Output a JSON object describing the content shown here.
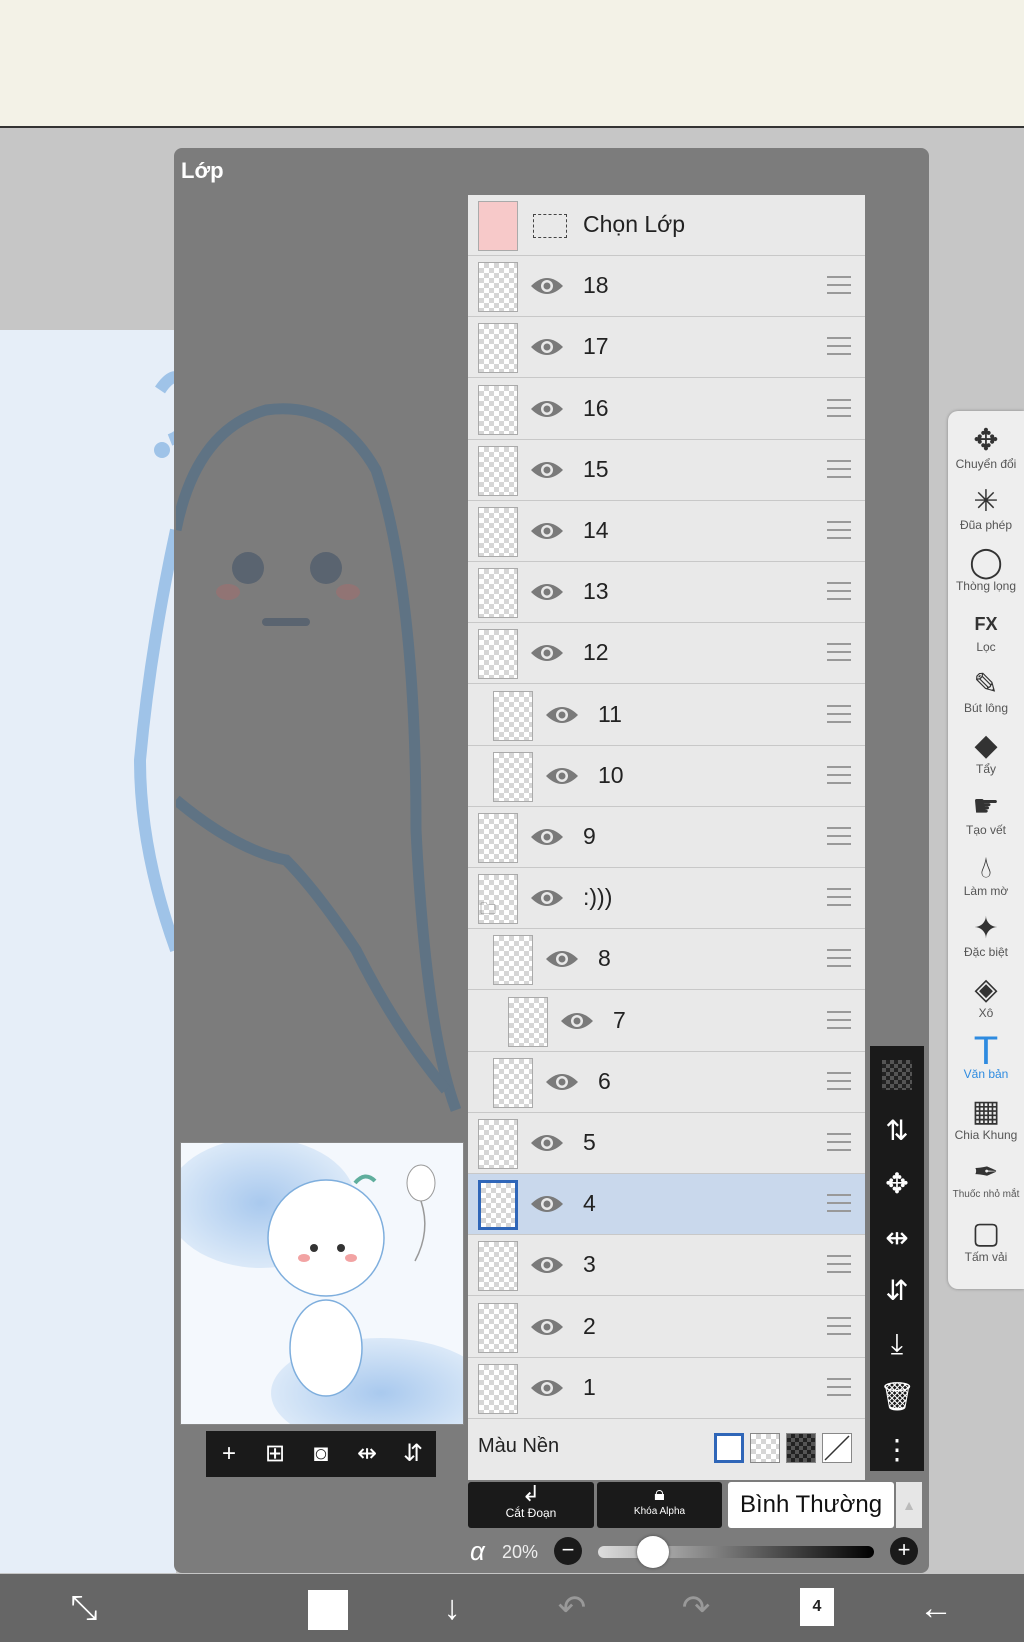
{
  "panel": {
    "title": "Lớp"
  },
  "select_layer": {
    "label": "Chọn Lớp"
  },
  "layers": [
    {
      "name": "18"
    },
    {
      "name": "17"
    },
    {
      "name": "16"
    },
    {
      "name": "15"
    },
    {
      "name": "14"
    },
    {
      "name": "13"
    },
    {
      "name": "12"
    },
    {
      "name": "11"
    },
    {
      "name": "10"
    },
    {
      "name": "9"
    },
    {
      "name": ":)))"
    },
    {
      "name": "8"
    },
    {
      "name": "7"
    },
    {
      "name": "6"
    },
    {
      "name": "5"
    },
    {
      "name": "4",
      "selected": true
    },
    {
      "name": "3"
    },
    {
      "name": "2"
    },
    {
      "name": "1"
    }
  ],
  "background": {
    "label": "Màu Nền"
  },
  "buttons": {
    "clipping": "Cắt Đoạn",
    "alpha_lock": "Khóa Alpha"
  },
  "blend_mode": {
    "value": "Bình Thường"
  },
  "opacity": {
    "symbol": "α",
    "value": "20%",
    "level": 0.2
  },
  "tools": [
    {
      "label": "Chuyển đổi",
      "icon": "move-arrows-icon"
    },
    {
      "label": "Đũa phép",
      "icon": "magic-wand-icon"
    },
    {
      "label": "Thòng lọng",
      "icon": "lasso-icon"
    },
    {
      "label": "Lọc",
      "icon": "fx-filter-icon"
    },
    {
      "label": "Bút lông",
      "icon": "brush-icon"
    },
    {
      "label": "Tẩy",
      "icon": "eraser-icon"
    },
    {
      "label": "Tạo vết",
      "icon": "smudge-icon"
    },
    {
      "label": "Làm mờ",
      "icon": "blur-drop-icon"
    },
    {
      "label": "Đặc biệt",
      "icon": "special-brush-icon"
    },
    {
      "label": "Xô",
      "icon": "bucket-icon"
    },
    {
      "label": "Văn bản",
      "icon": "text-icon",
      "active": true
    },
    {
      "label": "Chia Khung",
      "icon": "frame-divider-icon"
    },
    {
      "label": "Thuốc nhỏ mắt",
      "icon": "eyedropper-icon"
    },
    {
      "label": "Tấm vải",
      "icon": "canvas-icon"
    }
  ],
  "bottom_bar": {
    "layer_count": "4"
  },
  "colors": {
    "selected_row": "#c9d8ec",
    "accent": "#2e8be0",
    "panel": "#7c7c7c",
    "toolbar": "#eeeeee"
  }
}
